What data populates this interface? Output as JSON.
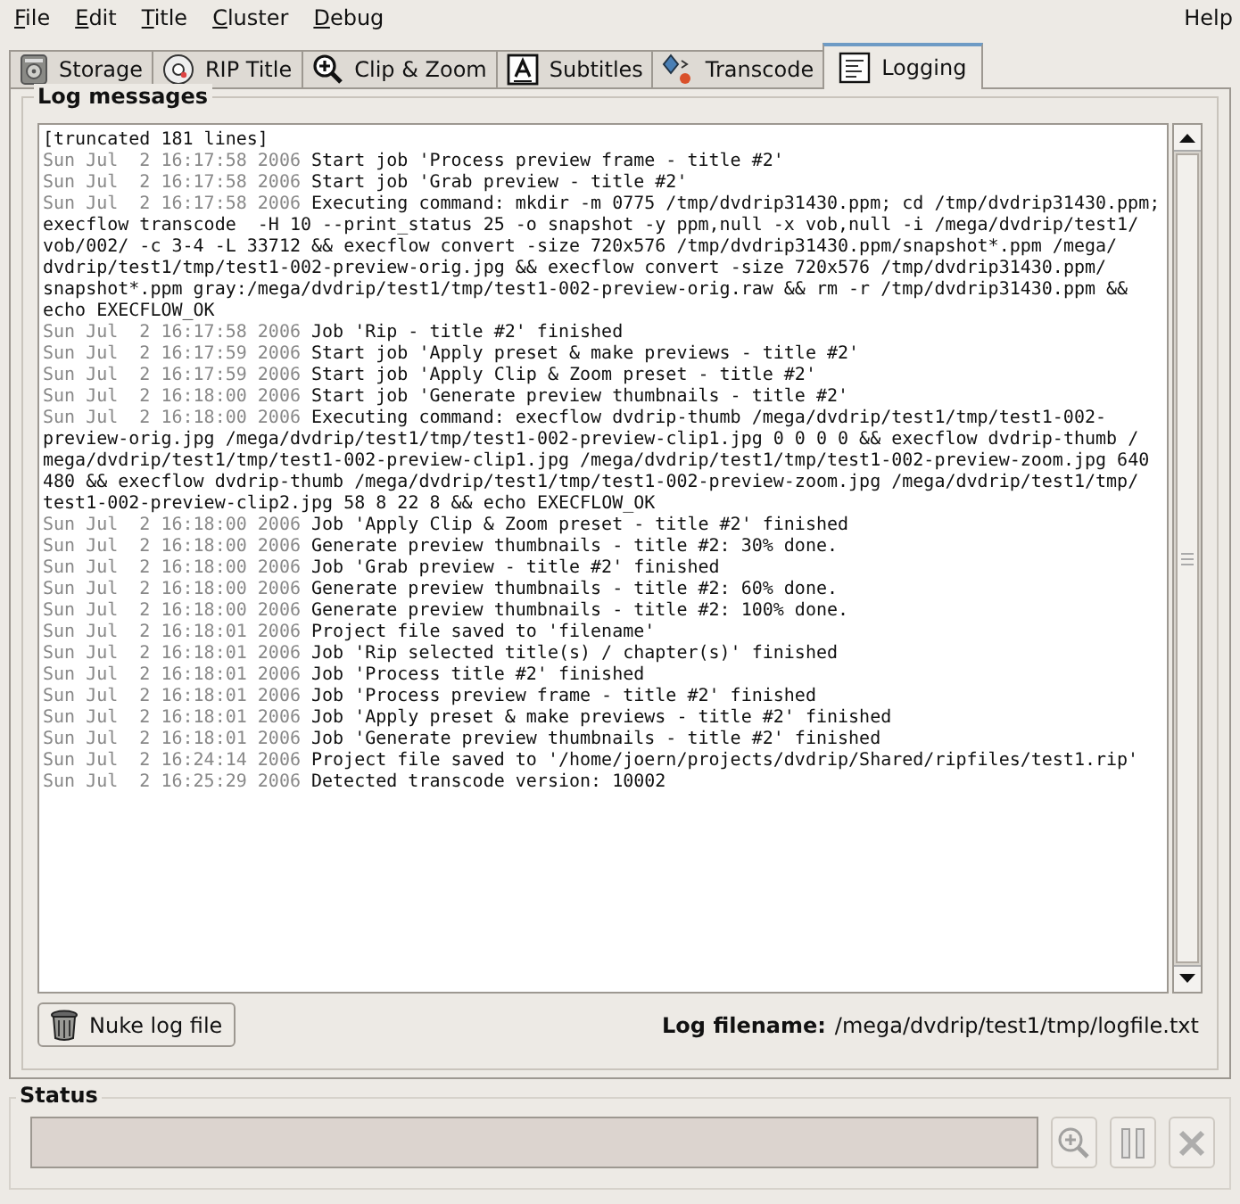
{
  "menu": {
    "left": [
      {
        "label": "File"
      },
      {
        "label": "Edit"
      },
      {
        "label": "Title"
      },
      {
        "label": "Cluster"
      },
      {
        "label": "Debug"
      }
    ],
    "right": [
      {
        "label": "Help"
      }
    ]
  },
  "tabs": [
    {
      "label": "Storage",
      "kind": "storage",
      "selected": false
    },
    {
      "label": "RIP Title",
      "kind": "disc",
      "selected": false
    },
    {
      "label": "Clip & Zoom",
      "kind": "zoom",
      "selected": false
    },
    {
      "label": "Subtitles",
      "kind": "subtitles",
      "selected": false
    },
    {
      "label": "Transcode",
      "kind": "transcode",
      "selected": false
    },
    {
      "label": "Logging",
      "kind": "log",
      "selected": true
    }
  ],
  "log_panel": {
    "title": "Log messages",
    "header": "[truncated 181 lines]",
    "entries": [
      {
        "time": "Sun Jul  2 16:17:58 2006",
        "message": "Start job 'Process preview frame - title #2'"
      },
      {
        "time": "Sun Jul  2 16:17:58 2006",
        "message": "Start job 'Grab preview - title #2'"
      },
      {
        "time": "Sun Jul  2 16:17:58 2006",
        "message": "Executing command: mkdir -m 0775 /tmp/dvdrip31430.ppm; cd /tmp/dvdrip31430.ppm;\nexecflow transcode  -H 10 --print_status 25 -o snapshot -y ppm,null -x vob,null -i /mega/dvdrip/test1/\nvob/002/ -c 3-4 -L 33712 && execflow convert -size 720x576 /tmp/dvdrip31430.ppm/snapshot*.ppm /mega/\ndvdrip/test1/tmp/test1-002-preview-orig.jpg && execflow convert -size 720x576 /tmp/dvdrip31430.ppm/\nsnapshot*.ppm gray:/mega/dvdrip/test1/tmp/test1-002-preview-orig.raw && rm -r /tmp/dvdrip31430.ppm &&\necho EXECFLOW_OK"
      },
      {
        "time": "Sun Jul  2 16:17:58 2006",
        "message": "Job 'Rip - title #2' finished"
      },
      {
        "time": "Sun Jul  2 16:17:59 2006",
        "message": "Start job 'Apply preset & make previews - title #2'"
      },
      {
        "time": "Sun Jul  2 16:17:59 2006",
        "message": "Start job 'Apply Clip & Zoom preset - title #2'"
      },
      {
        "time": "Sun Jul  2 16:18:00 2006",
        "message": "Start job 'Generate preview thumbnails - title #2'"
      },
      {
        "time": "Sun Jul  2 16:18:00 2006",
        "message": "Executing command: execflow dvdrip-thumb /mega/dvdrip/test1/tmp/test1-002-\npreview-orig.jpg /mega/dvdrip/test1/tmp/test1-002-preview-clip1.jpg 0 0 0 0 && execflow dvdrip-thumb /\nmega/dvdrip/test1/tmp/test1-002-preview-clip1.jpg /mega/dvdrip/test1/tmp/test1-002-preview-zoom.jpg 640\n480 && execflow dvdrip-thumb /mega/dvdrip/test1/tmp/test1-002-preview-zoom.jpg /mega/dvdrip/test1/tmp/\ntest1-002-preview-clip2.jpg 58 8 22 8 && echo EXECFLOW_OK"
      },
      {
        "time": "Sun Jul  2 16:18:00 2006",
        "message": "Job 'Apply Clip & Zoom preset - title #2' finished"
      },
      {
        "time": "Sun Jul  2 16:18:00 2006",
        "message": "Generate preview thumbnails - title #2: 30% done."
      },
      {
        "time": "Sun Jul  2 16:18:00 2006",
        "message": "Job 'Grab preview - title #2' finished"
      },
      {
        "time": "Sun Jul  2 16:18:00 2006",
        "message": "Generate preview thumbnails - title #2: 60% done."
      },
      {
        "time": "Sun Jul  2 16:18:00 2006",
        "message": "Generate preview thumbnails - title #2: 100% done."
      },
      {
        "time": "Sun Jul  2 16:18:01 2006",
        "message": "Project file saved to 'filename'"
      },
      {
        "time": "Sun Jul  2 16:18:01 2006",
        "message": "Job 'Rip selected title(s) / chapter(s)' finished"
      },
      {
        "time": "Sun Jul  2 16:18:01 2006",
        "message": "Job 'Process title #2' finished"
      },
      {
        "time": "Sun Jul  2 16:18:01 2006",
        "message": "Job 'Process preview frame - title #2' finished"
      },
      {
        "time": "Sun Jul  2 16:18:01 2006",
        "message": "Job 'Apply preset & make previews - title #2' finished"
      },
      {
        "time": "Sun Jul  2 16:18:01 2006",
        "message": "Job 'Generate preview thumbnails - title #2' finished"
      },
      {
        "time": "Sun Jul  2 16:24:14 2006",
        "message": "Project file saved to '/home/joern/projects/dvdrip/Shared/ripfiles/test1.rip'"
      },
      {
        "time": "Sun Jul  2 16:25:29 2006",
        "message": "Detected transcode version: 10002"
      }
    ],
    "nuke_button": "Nuke log file",
    "filename_label": "Log filename:",
    "filename": "/mega/dvdrip/test1/tmp/logfile.txt"
  },
  "status": {
    "title": "Status",
    "progress": {
      "level": 0
    },
    "buttons": [
      {
        "kind": "zoom",
        "disabled": true
      },
      {
        "kind": "pause",
        "disabled": true
      },
      {
        "kind": "cancel",
        "disabled": true
      }
    ]
  }
}
